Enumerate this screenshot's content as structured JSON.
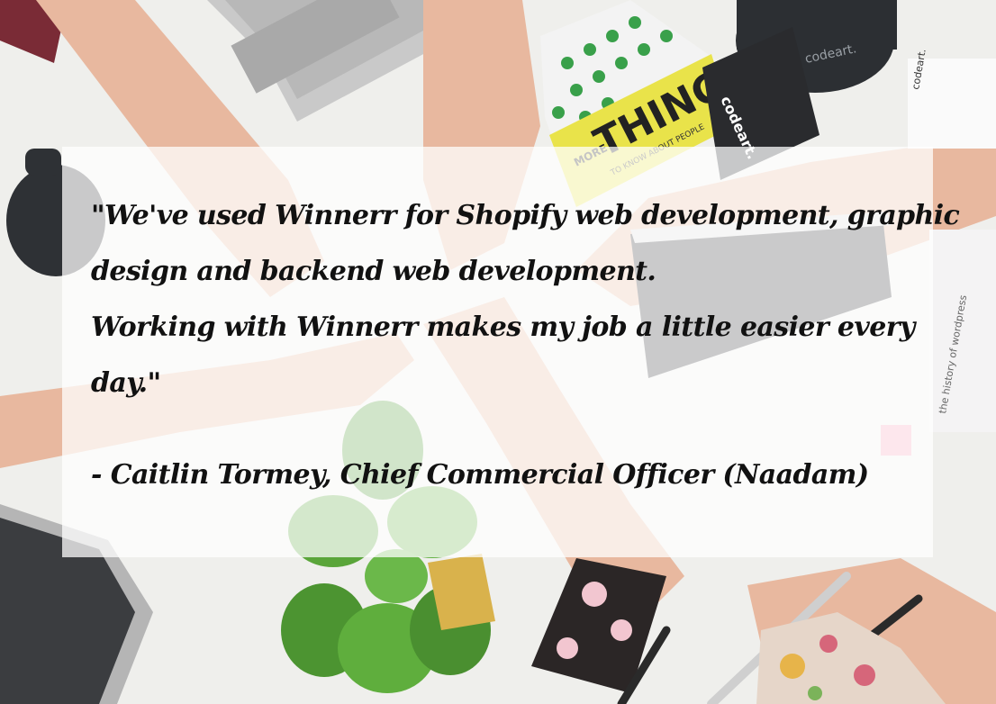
{
  "photo": {
    "mug_brand": "codeart.",
    "book_title_small": "MORE",
    "book_title_big": "THINGS",
    "book_subtitle": "TO KNOW ABOUT PEOPLE",
    "book_spine_brand": "codeart.",
    "notepad_brand": "codeart.",
    "sticky_text": "the history of wordpress"
  },
  "testimonial": {
    "lines": [
      "\"We've used Winnerr for Shopify web development, graphic",
      "design and backend web development.",
      "Working with Winnerr makes my job a little easier every",
      "day.\""
    ],
    "attribution": "- Caitlin Tormey, Chief Commercial Officer (Naadam)"
  },
  "colors": {
    "panel_overlay": "rgba(255,255,255,0.74)",
    "text": "#111111"
  }
}
